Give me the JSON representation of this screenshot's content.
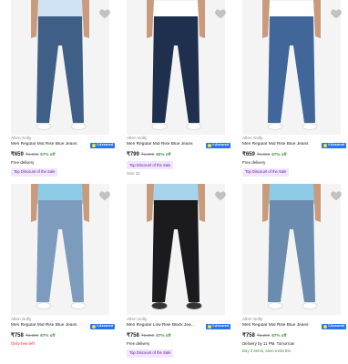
{
  "products": [
    {
      "brand": "Allen Solly",
      "title": "Men Regular Mid Rise Blue Jeans",
      "price": "₹659",
      "mrp": "₹1,999",
      "discount": "67% off",
      "line1": "Free delivery",
      "tag": "Top Discount of the Sale",
      "color": "#3f5f86"
    },
    {
      "brand": "Allen Solly",
      "title": "Men Regular Mid Rise Blue Jeans",
      "price": "₹799",
      "mrp": "₹1,999",
      "discount": "60% off",
      "line1": "Top Discount of the Sale",
      "tag": "Size 32",
      "color": "#1f2f4e"
    },
    {
      "brand": "Allen Solly",
      "title": "Men Regular Mid Rise Blue Jeans",
      "price": "₹659",
      "mrp": "₹1,999",
      "discount": "67% off",
      "line1": "Free delivery",
      "tag": "Top Discount of the Sale",
      "color": "#41679a"
    },
    {
      "brand": "Allen Solly",
      "title": "Men Regular Mid Rise Blue Jeans",
      "price": "₹758",
      "mrp": "₹2,299",
      "discount": "67% off",
      "line1": "Only few left",
      "tag": "",
      "color": "#7d9cbd"
    },
    {
      "brand": "Allen Solly",
      "title": "Men Regular Low Rise Black Jea...",
      "price": "₹758",
      "mrp": "₹2,299",
      "discount": "67% off",
      "line1": "Free delivery",
      "tag": "Top Discount of the Sale",
      "color": "#1b1b1d"
    },
    {
      "brand": "Allen Solly",
      "title": "Men Regular Mid Rise Blue Jeans",
      "price": "₹758",
      "mrp": "₹2,299",
      "discount": "67% off",
      "line1": "Delivery by 11 PM, Tomorrow",
      "tag": "Buy 3 items, save extra 5%",
      "color": "#6c8caf"
    }
  ],
  "assured_label": "f-Assured",
  "icons": {
    "wishlist": "heart-icon",
    "assured": "flipkart-assured-icon"
  }
}
